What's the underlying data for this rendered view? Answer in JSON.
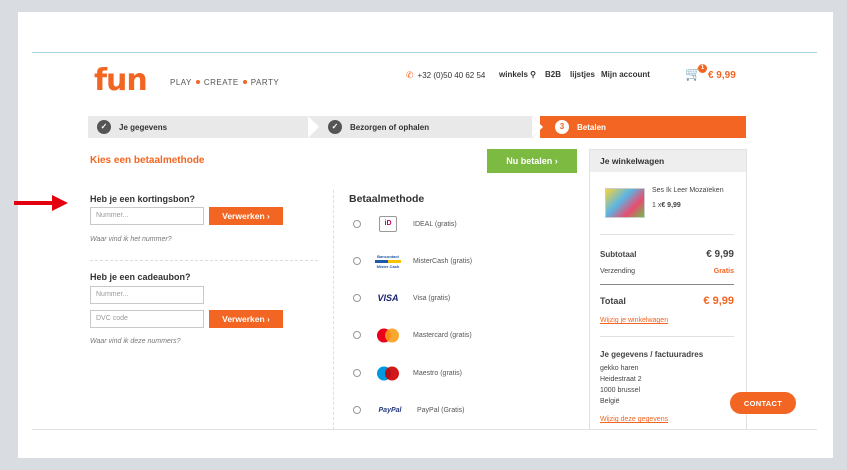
{
  "header": {
    "logo": "fun",
    "tagline": [
      "PLAY",
      "CREATE",
      "PARTY"
    ],
    "phone": "+32 (0)50 40 62 54",
    "nav": [
      "winkels",
      "B2B",
      "lijstjes",
      "Mijn account"
    ],
    "cart_count": "1",
    "cart_total": "€ 9,99"
  },
  "steps": [
    {
      "num": "✓",
      "label": "Je gegevens"
    },
    {
      "num": "✓",
      "label": "Bezorgen of ophalen"
    },
    {
      "num": "3",
      "label": "Betalen"
    }
  ],
  "main": {
    "title": "Kies een betaalmethode",
    "pay_now": "Nu betalen  ›"
  },
  "discount": {
    "label": "Heb je een kortingsbon?",
    "placeholder": "Nummer...",
    "button": "Verwerken  ›",
    "help": "Waar vind ik het nummer?"
  },
  "giftcard": {
    "label": "Heb je een cadeaubon?",
    "placeholder_number": "Nummer...",
    "placeholder_dvc": "DVC code",
    "button": "Verwerken  ›",
    "help": "Waar vind ik deze nummers?"
  },
  "payment": {
    "title": "Betaalmethode",
    "methods": [
      {
        "name": "IDEAL (gratis)",
        "icon": "ideal-logo"
      },
      {
        "name": "MisterCash (gratis)",
        "icon": "bancontact-logo"
      },
      {
        "name": "Visa (gratis)",
        "icon": "visa-logo"
      },
      {
        "name": "Mastercard (gratis)",
        "icon": "mastercard-logo"
      },
      {
        "name": "Maestro (gratis)",
        "icon": "maestro-logo"
      },
      {
        "name": "PayPal (Gratis)",
        "icon": "paypal-logo"
      }
    ],
    "logo_text": {
      "visa": "VISA",
      "paypal": "PayPal",
      "bancontact_top": "Bancontact",
      "bancontact_bottom": "Mister Cash",
      "ideal": "iD"
    }
  },
  "cart_sidebar": {
    "title": "Je winkelwagen",
    "product_name": "Ses Ik Leer Mozaïeken",
    "product_qty": "1 x",
    "product_price": "€ 9,99",
    "subtotal_label": "Subtotaal",
    "subtotal_value": "€ 9,99",
    "shipping_label": "Verzending",
    "shipping_value": "Gratis",
    "total_label": "Totaal",
    "total_value": "€ 9,99",
    "edit_cart": "Wijzig je winkelwagen",
    "address_title": "Je gegevens / factuuradres",
    "address": [
      "gekko haren",
      "Heidestraat 2",
      "1000 brussel",
      "België"
    ],
    "edit_details": "Wijzig deze gegevens"
  },
  "contact_button": "CONTACT",
  "colors": {
    "accent": "#f26522",
    "green": "#7cba42"
  }
}
